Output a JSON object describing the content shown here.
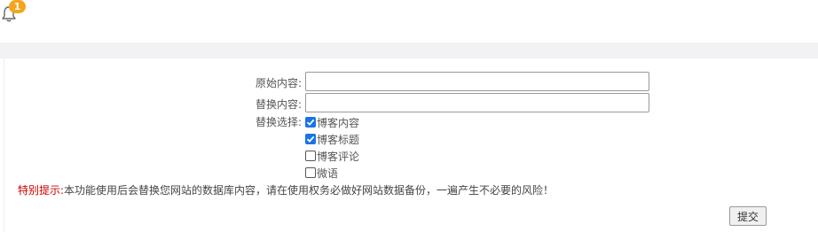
{
  "header": {
    "notification_count": "1",
    "icon": "bell-icon",
    "badge_color": "#f4a51c"
  },
  "form": {
    "original_label": "原始内容:",
    "original_value": "",
    "replace_label": "替换内容:",
    "replace_value": "",
    "choice_label": "替换选择:",
    "options": [
      {
        "label": "博客内容",
        "checked": true
      },
      {
        "label": "博客标题",
        "checked": true
      },
      {
        "label": "博客评论",
        "checked": false
      },
      {
        "label": "微语",
        "checked": false
      }
    ],
    "checkbox_color": "#1a73e8"
  },
  "tip": {
    "prefix": "特别提示:",
    "text": "本功能使用后会替换您网站的数据库内容，请在使用权务必做好网站数据备份，一遍产生不必要的风险！",
    "prefix_color": "#cc0000"
  },
  "submit_label": "提交"
}
